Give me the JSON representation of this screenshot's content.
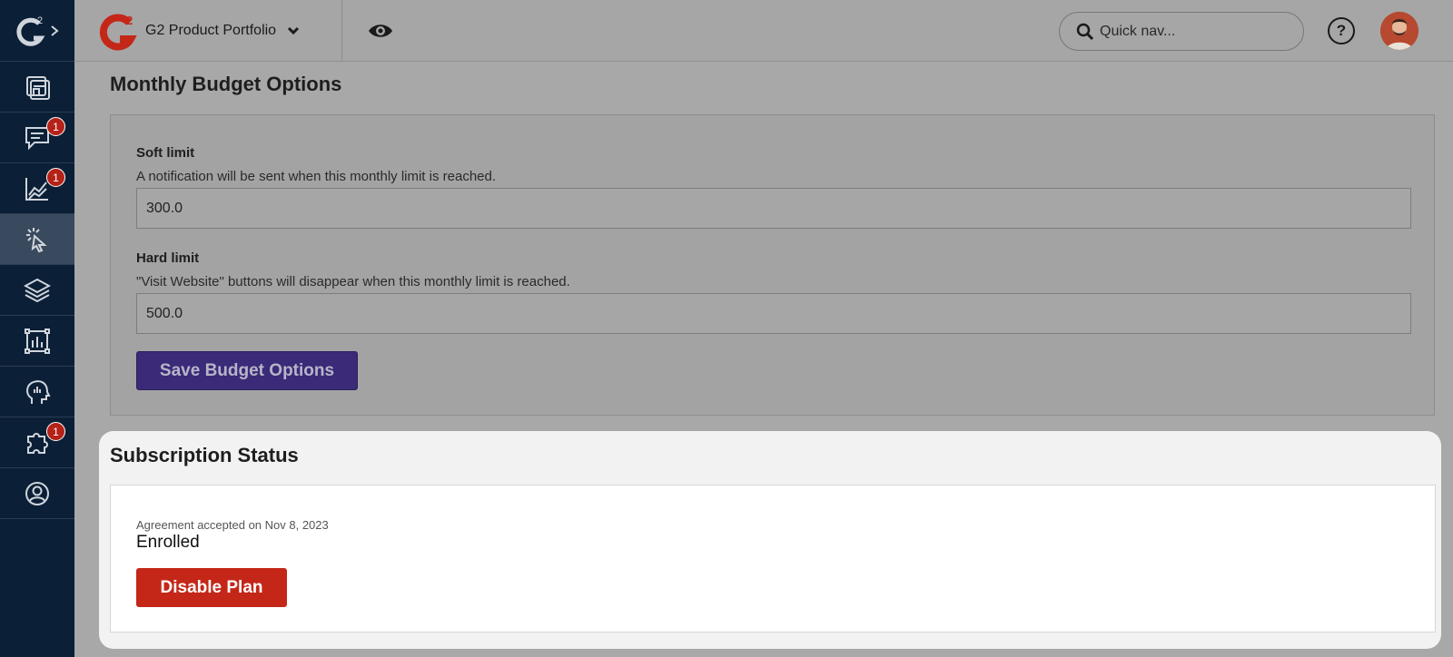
{
  "header": {
    "brand": "G2 Product Portfolio",
    "search_placeholder": "Quick nav...",
    "help_label": "?"
  },
  "sidebar": {
    "items": [
      {
        "icon": "dashboard-icon",
        "badge": ""
      },
      {
        "icon": "chat-icon",
        "badge": "1"
      },
      {
        "icon": "analytics-icon",
        "badge": "1"
      },
      {
        "icon": "cursor-click-icon",
        "badge": ""
      },
      {
        "icon": "layers-icon",
        "badge": ""
      },
      {
        "icon": "chart-frame-icon",
        "badge": ""
      },
      {
        "icon": "head-insights-icon",
        "badge": ""
      },
      {
        "icon": "puzzle-icon",
        "badge": "1"
      },
      {
        "icon": "user-circle-icon",
        "badge": ""
      }
    ]
  },
  "budget": {
    "title": "Monthly Budget Options",
    "soft_label": "Soft limit",
    "soft_help": "A notification will be sent when this monthly limit is reached.",
    "soft_value": "300.0",
    "hard_label": "Hard limit",
    "hard_help": "\"Visit Website\" buttons will disappear when this monthly limit is reached.",
    "hard_value": "500.0",
    "save_label": "Save Budget Options"
  },
  "subscription": {
    "title": "Subscription Status",
    "agreement": "Agreement accepted on Nov 8, 2023",
    "status": "Enrolled",
    "disable_label": "Disable Plan"
  },
  "colors": {
    "sidebar": "#0b1f36",
    "primary_button": "#3a2a78",
    "danger_button": "#c42718",
    "badge": "#b52219"
  }
}
